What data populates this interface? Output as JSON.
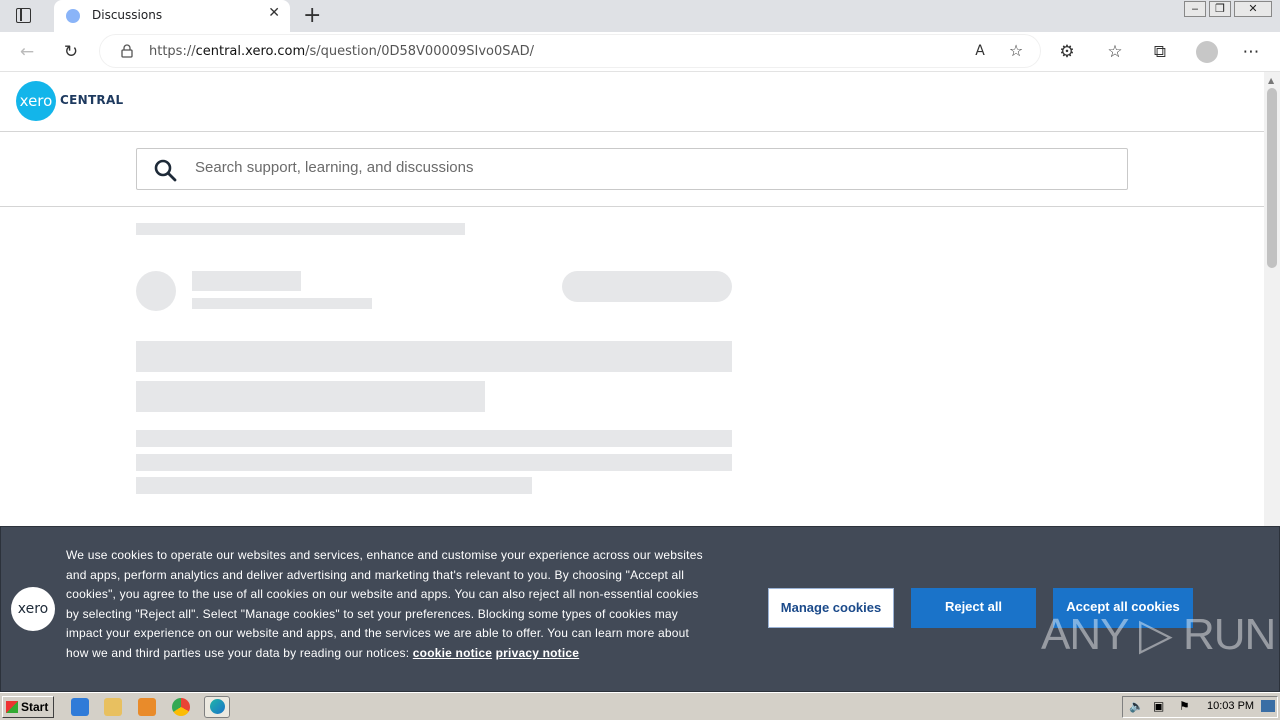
{
  "browser": {
    "tab_title": "Discussions",
    "tab_close": "✕",
    "new_tab": "+",
    "url_prefix": "https://",
    "url_host": "central.xero.com",
    "url_path": "/s/question/0D58V00009SIvo0SAD/",
    "window_buttons": [
      "▭",
      "❐",
      "✕"
    ],
    "read_aloud_label": "A͡"
  },
  "header": {
    "logo_text": "xero",
    "brand_text": "CENTRAL",
    "brand_color": "#13b5ea"
  },
  "search": {
    "placeholder": "Search support, learning, and discussions"
  },
  "cookie_banner": {
    "logo_text": "xero",
    "text": "We use cookies to operate our websites and services, enhance and customise your experience across our websites and apps, perform analytics and deliver advertising and marketing that's relevant to you. By choosing \"Accept all cookies\", you agree to the use of all cookies on our website and apps. You can also reject all non-essential cookies by selecting \"Reject all\". Select \"Manage cookies\" to set your preferences. Blocking some types of cookies may impact your experience on our website and apps, and the services we are able to offer. You can learn more about how we and third parties use your data by reading our notices: ",
    "link_cookie": "cookie notice",
    "link_privacy": "privacy notice",
    "manage_label": "Manage cookies",
    "reject_label": "Reject all",
    "accept_label": "Accept all cookies",
    "button_color": "#1a73c9",
    "background_color": "#424a57"
  },
  "watermark": "ANY ▷ RUN",
  "taskbar": {
    "start_label": "Start",
    "clock": "10:03 PM"
  }
}
